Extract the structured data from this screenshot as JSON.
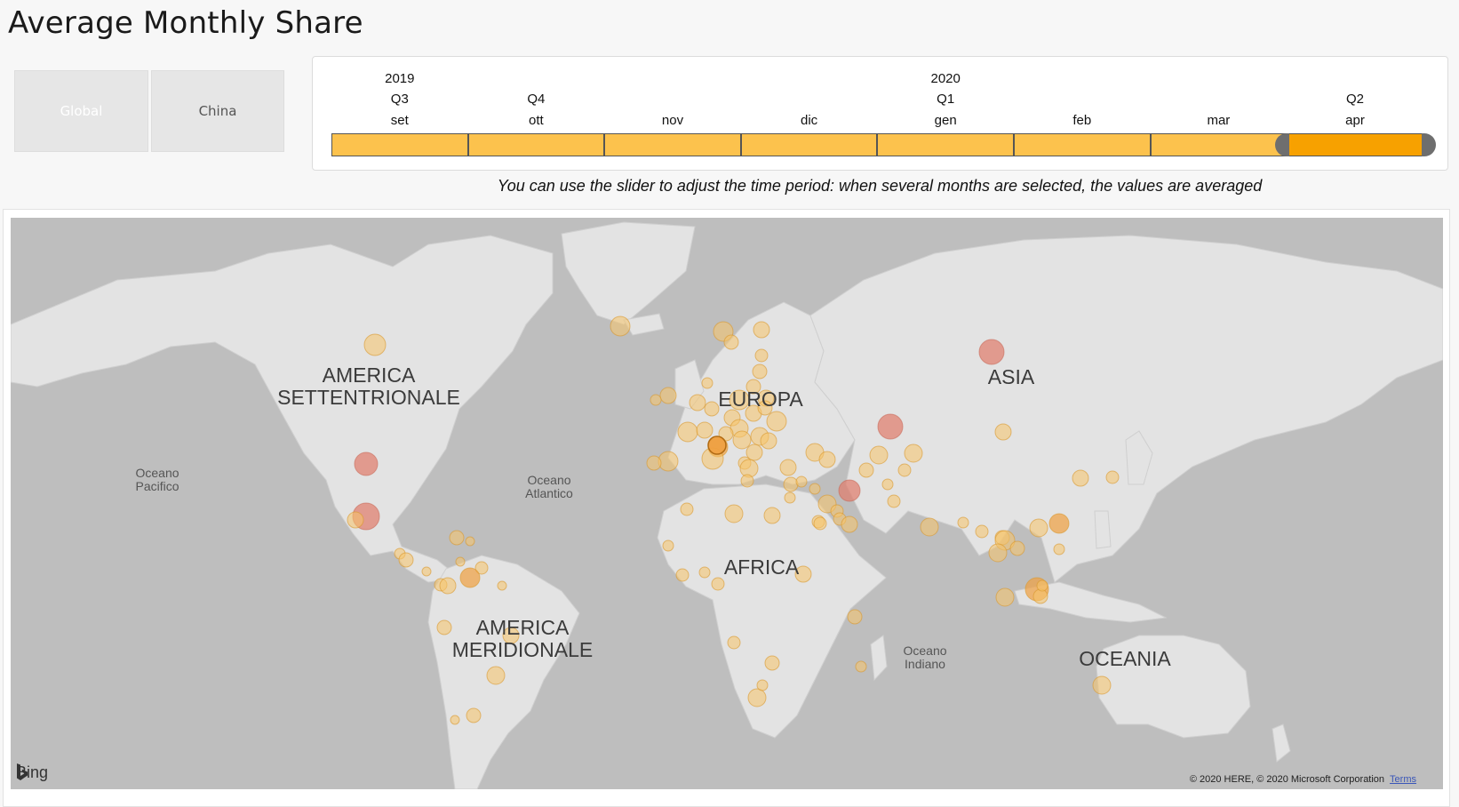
{
  "title": "Average Monthly Share",
  "buttons": {
    "global": "Global",
    "china": "China"
  },
  "timeline": {
    "years": [
      {
        "label": "2019",
        "col": 0
      },
      {
        "label": "2020",
        "col": 4
      }
    ],
    "quarters": [
      {
        "label": "Q3",
        "col": 0
      },
      {
        "label": "Q4",
        "col": 1
      },
      {
        "label": "Q1",
        "col": 4
      },
      {
        "label": "Q2",
        "col": 7
      }
    ],
    "months": [
      "set",
      "ott",
      "nov",
      "dic",
      "gen",
      "feb",
      "mar",
      "apr"
    ],
    "selected": [
      "apr"
    ],
    "colors": {
      "unselected": "#fcc24d",
      "selected": "#f7a100",
      "handle": "#6e6e6e"
    }
  },
  "caption": "You can use the slider to adjust the time period: when several months are selected, the values are averaged",
  "map": {
    "regions": {
      "north_america": [
        "AMERICA",
        "SETTENTRIONALE"
      ],
      "europe": [
        "EUROPA"
      ],
      "asia": [
        "ASIA"
      ],
      "africa": [
        "AFRICA"
      ],
      "south_america": [
        "AMERICA",
        "MERIDIONALE"
      ],
      "oceania": [
        "OCEANIA"
      ]
    },
    "oceans": {
      "pacific": [
        "Oceano",
        "Pacifico"
      ],
      "atlantic": [
        "Oceano",
        "Atlantico"
      ],
      "indian": [
        "Oceano",
        "Indiano"
      ]
    },
    "attribution": {
      "logo": "Bing",
      "copyright": "© 2020 HERE, © 2020 Microsoft Corporation",
      "terms": "Terms"
    },
    "colors": {
      "water": "#bebebe",
      "land": "#e3e3e3",
      "bubble_low": "#f7c46a",
      "bubble_mid": "#f0a040",
      "bubble_high": "#e07a6a"
    }
  }
}
